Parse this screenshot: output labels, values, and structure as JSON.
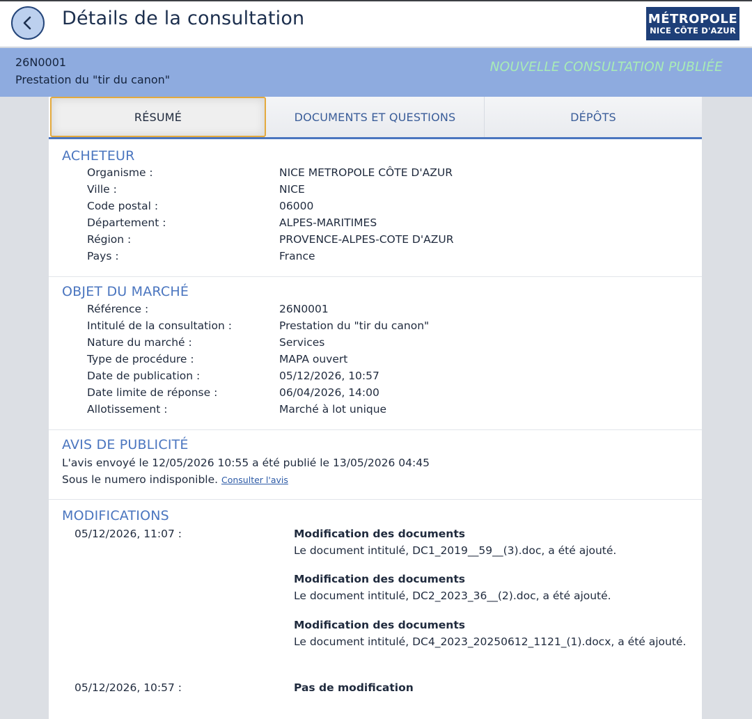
{
  "header": {
    "title": "Détails de la consultation",
    "logo_line1": "MÉTROPOLE",
    "logo_line2": "NICE CÔTE D'AZUR"
  },
  "banner": {
    "reference": "26N0001",
    "intitule": "Prestation du \"tir du canon\"",
    "status": "NOUVELLE CONSULTATION PUBLIÉE"
  },
  "tabs": [
    {
      "label": "RÉSUMÉ",
      "active": true
    },
    {
      "label": "DOCUMENTS ET QUESTIONS",
      "active": false
    },
    {
      "label": "DÉPÔTS",
      "active": false
    }
  ],
  "acheteur": {
    "title": "ACHETEUR",
    "rows": [
      {
        "label": "Organisme :",
        "value": "NICE METROPOLE CÔTE D'AZUR"
      },
      {
        "label": "Ville :",
        "value": "NICE"
      },
      {
        "label": "Code postal :",
        "value": "06000"
      },
      {
        "label": "Département :",
        "value": "ALPES-MARITIMES"
      },
      {
        "label": "Région :",
        "value": "PROVENCE-ALPES-COTE D'AZUR"
      },
      {
        "label": "Pays :",
        "value": "France"
      }
    ]
  },
  "objet": {
    "title": "OBJET DU MARCHÉ",
    "rows": [
      {
        "label": "Référence :",
        "value": "26N0001"
      },
      {
        "label": "Intitulé de la consultation :",
        "value": "Prestation du \"tir du canon\""
      },
      {
        "label": "Nature du marché :",
        "value": "Services"
      },
      {
        "label": "Type de procédure :",
        "value": "MAPA ouvert"
      },
      {
        "label": "Date de publication :",
        "value": "05/12/2026, 10:57"
      },
      {
        "label": "Date limite de réponse :",
        "value": "06/04/2026, 14:00"
      },
      {
        "label": "Allotissement :",
        "value": "Marché à lot unique"
      }
    ]
  },
  "avis": {
    "title": "AVIS DE PUBLICITÉ",
    "line1": "L'avis envoyé le 12/05/2026 10:55 a été publié le 13/05/2026 04:45",
    "line2": "Sous le numero indisponible.",
    "link": "Consulter l'avis"
  },
  "modifications": {
    "title": "MODIFICATIONS",
    "entries": [
      {
        "date": "05/12/2026, 11:07 :",
        "items": [
          {
            "title": "Modification des documents",
            "desc": "Le document intitulé, DC1_2019__59__(3).doc, a été ajouté."
          },
          {
            "title": "Modification des documents",
            "desc": "Le document intitulé, DC2_2023_36__(2).doc, a été ajouté."
          },
          {
            "title": "Modification des documents",
            "desc": "Le document intitulé, DC4_2023_20250612_1121_(1).docx, a été ajouté."
          }
        ]
      },
      {
        "date": "05/12/2026, 10:57 :",
        "items": [
          {
            "title": "Pas de modification",
            "desc": ""
          }
        ]
      }
    ]
  }
}
